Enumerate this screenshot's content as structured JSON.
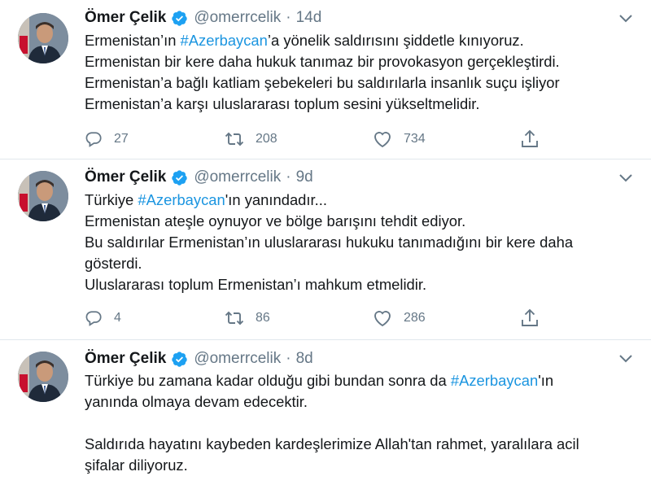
{
  "colors": {
    "link": "#1b95e0",
    "verified": "#1da1f2",
    "secondary_text": "#657786",
    "primary_text": "#14171a"
  },
  "icons": {
    "verified": "verified-badge-icon",
    "caret": "chevron-down-icon",
    "reply": "reply-icon",
    "retweet": "retweet-icon",
    "like": "heart-icon",
    "share": "share-icon"
  },
  "tweets": [
    {
      "author": "Ömer Çelik",
      "handle": "@omerrcelik",
      "separator": "·",
      "time": "14d",
      "lines": [
        [
          {
            "text": "Ermenistan’ın "
          },
          {
            "text": "#Azerbaycan",
            "hashtag": true
          },
          {
            "text": "’a yönelik saldırısını şiddetle kınıyoruz."
          }
        ],
        [
          {
            "text": "Ermenistan bir kere daha hukuk tanımaz bir provokasyon gerçekleştirdi."
          }
        ],
        [
          {
            "text": "Ermenistan’a bağlı katliam şebekeleri bu saldırılarla insanlık suçu işliyor"
          }
        ],
        [
          {
            "text": "Ermenistan’a karşı uluslararası toplum sesini yükseltmelidir."
          }
        ]
      ],
      "replies": "27",
      "retweets": "208",
      "likes": "734"
    },
    {
      "author": "Ömer Çelik",
      "handle": "@omerrcelik",
      "separator": "·",
      "time": "9d",
      "lines": [
        [
          {
            "text": "Türkiye "
          },
          {
            "text": "#Azerbaycan",
            "hashtag": true
          },
          {
            "text": "'ın yanındadır..."
          }
        ],
        [
          {
            "text": "Ermenistan ateşle oynuyor ve bölge barışını tehdit ediyor."
          }
        ],
        [
          {
            "text": "Bu saldırılar Ermenistan’ın uluslararası hukuku tanımadığını bir kere daha"
          }
        ],
        [
          {
            "text": "gösterdi."
          }
        ],
        [
          {
            "text": "Uluslararası toplum Ermenistan’ı mahkum etmelidir."
          }
        ]
      ],
      "replies": "4",
      "retweets": "86",
      "likes": "286"
    },
    {
      "author": "Ömer Çelik",
      "handle": "@omerrcelik",
      "separator": "·",
      "time": "8d",
      "lines": [
        [
          {
            "text": "Türkiye bu zamana kadar olduğu gibi bundan sonra da "
          },
          {
            "text": "#Azerbaycan",
            "hashtag": true
          },
          {
            "text": "'ın"
          }
        ],
        [
          {
            "text": "yanında olmaya devam edecektir."
          }
        ],
        [],
        [
          {
            "text": "Saldırıda hayatını kaybeden kardeşlerimize Allah'tan rahmet, yaralılara acil"
          }
        ],
        [
          {
            "text": "şifalar diliyoruz."
          }
        ]
      ]
    }
  ]
}
